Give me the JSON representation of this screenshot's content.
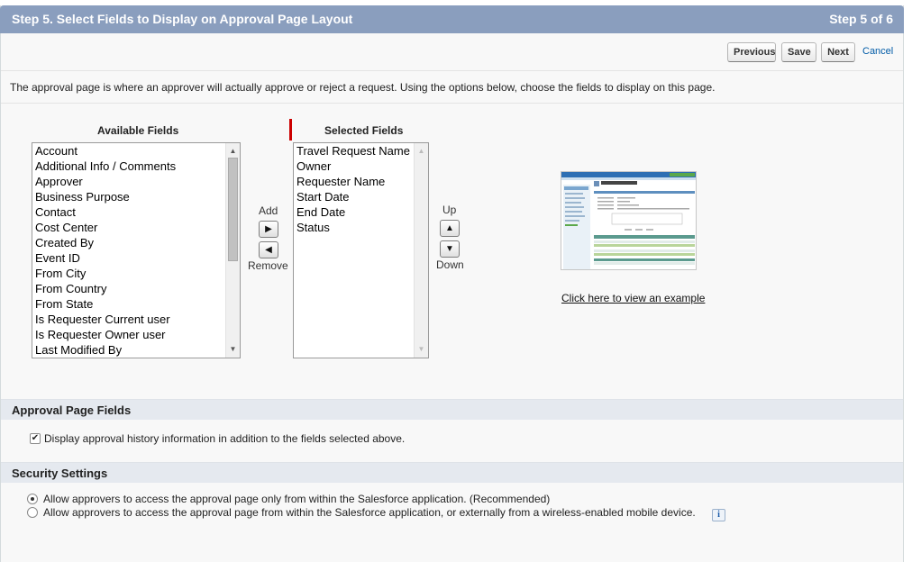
{
  "header": {
    "title": "Step 5. Select Fields to Display on Approval Page Layout",
    "step_count": "Step 5 of 6",
    "bg_color": "#8a9ebe"
  },
  "toolbar": {
    "previous_label": "Previous",
    "save_label": "Save",
    "next_label": "Next",
    "cancel_label": "Cancel"
  },
  "intro_text": "The approval page is where an approver will actually approve or reject a request. Using the options below, choose the fields to display on this page.",
  "available_fields": {
    "label": "Available Fields",
    "items": [
      "Account",
      "Additional Info / Comments",
      "Approver",
      "Business Purpose",
      "Contact",
      "Cost Center",
      "Created By",
      "Event ID",
      "From City",
      "From Country",
      "From State",
      "Is Requester Current user",
      "Is Requester Owner user",
      "Last Modified By"
    ]
  },
  "add_remove": {
    "add_label": "Add",
    "remove_label": "Remove",
    "add_icon": "arrow-right-icon",
    "remove_icon": "arrow-left-icon"
  },
  "selected_fields": {
    "label": "Selected Fields",
    "items": [
      "Travel Request Name",
      "Owner",
      "Requester Name",
      "Start Date",
      "End Date",
      "Status"
    ]
  },
  "reorder": {
    "up_label": "Up",
    "down_label": "Down",
    "up_icon": "arrow-up-icon",
    "down_icon": "arrow-down-icon"
  },
  "example": {
    "link_text": "Click here to view an example"
  },
  "approval_page_fields": {
    "heading": "Approval Page Fields",
    "checkbox_label": "Display approval history information in addition to the fields selected above.",
    "checked": true
  },
  "security_settings": {
    "heading": "Security Settings",
    "options": [
      {
        "label": "Allow approvers to access the approval page only from within the Salesforce application. (Recommended)",
        "selected": true
      },
      {
        "label": "Allow approvers to access the approval page from within the Salesforce application, or externally from a wireless-enabled mobile device.",
        "selected": false
      }
    ],
    "info_icon": "info-icon"
  }
}
